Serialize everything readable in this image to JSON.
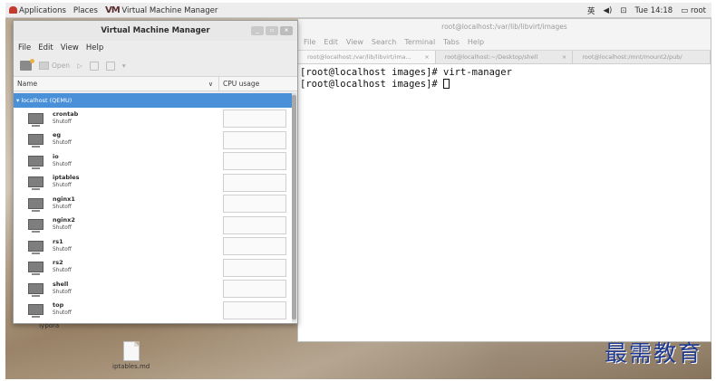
{
  "topbar": {
    "applications": "Applications",
    "places": "Places",
    "app_logo": "VM",
    "app_name": "Virtual Machine Manager",
    "input_method": "英",
    "volume": "◀)",
    "network": "⊡",
    "clock": "Tue 14:18",
    "user": "root"
  },
  "terminal": {
    "title": "root@localhost:/var/lib/libvirt/images",
    "menu": [
      "File",
      "Edit",
      "View",
      "Search",
      "Terminal",
      "Tabs",
      "Help"
    ],
    "tabs": [
      {
        "label": "root@localhost:/var/lib/libvirt/ima...",
        "close": "×"
      },
      {
        "label": "root@localhost:~/Desktop/shell",
        "close": "×"
      },
      {
        "label": "root@localhost:/mnt/mount2/pub/",
        "close": ""
      }
    ],
    "lines": [
      "[root@localhost images]# virt-manager",
      "[root@localhost images]# "
    ]
  },
  "vmm": {
    "title": "Virtual Machine Manager",
    "winbtns": [
      "_",
      "▫",
      "×"
    ],
    "menu": [
      "File",
      "Edit",
      "View",
      "Help"
    ],
    "toolbar": {
      "open": "Open",
      "play": "▷",
      "pause": "⏸",
      "stop": "▾"
    },
    "columns": {
      "name": "Name",
      "cpu": "CPU usage",
      "chevron": "∨"
    },
    "host": "▾ localhost (QEMU)",
    "vms": [
      {
        "name": "crontab",
        "state": "Shutoff"
      },
      {
        "name": "eg",
        "state": "Shutoff"
      },
      {
        "name": "io",
        "state": "Shutoff"
      },
      {
        "name": "iptables",
        "state": "Shutoff"
      },
      {
        "name": "nginx1",
        "state": "Shutoff"
      },
      {
        "name": "nginx2",
        "state": "Shutoff"
      },
      {
        "name": "rs1",
        "state": "Shutoff"
      },
      {
        "name": "rs2",
        "state": "Shutoff"
      },
      {
        "name": "shell",
        "state": "Shutoff"
      },
      {
        "name": "top",
        "state": "Shutoff"
      }
    ]
  },
  "desktop": {
    "typora": "Typora",
    "file": "iptables.md"
  },
  "watermark": "最需教育"
}
